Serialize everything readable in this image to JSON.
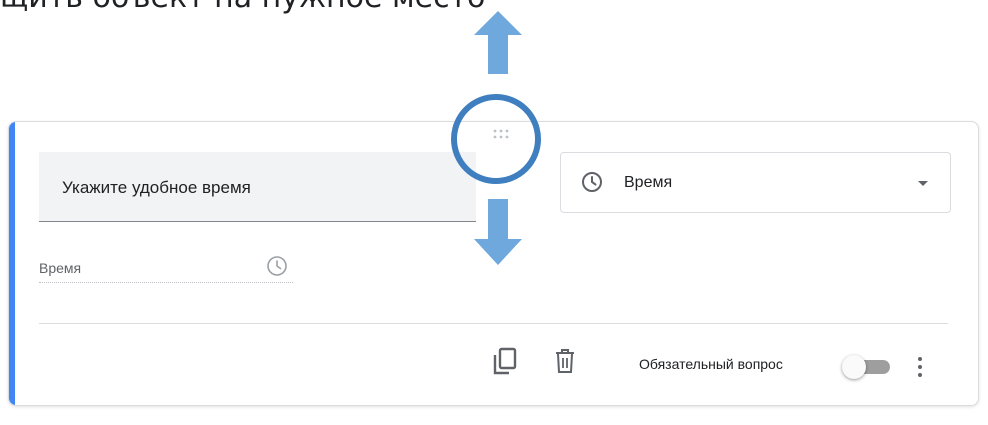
{
  "caption": "щить объект на нужное место",
  "question": {
    "title": "Укажите удобное время"
  },
  "question_type": {
    "icon": "clock-icon",
    "label": "Время"
  },
  "answer": {
    "placeholder": "Время",
    "icon": "clock-icon"
  },
  "footer": {
    "copy_icon": "copy-icon",
    "delete_icon": "trash-icon",
    "required_label": "Обязательный вопрос",
    "required_toggle_on": false,
    "more_icon": "more-vert-icon"
  },
  "colors": {
    "accent": "#4285f4",
    "annotation": "#3f7fbf",
    "arrow": "#6fa8dc"
  }
}
